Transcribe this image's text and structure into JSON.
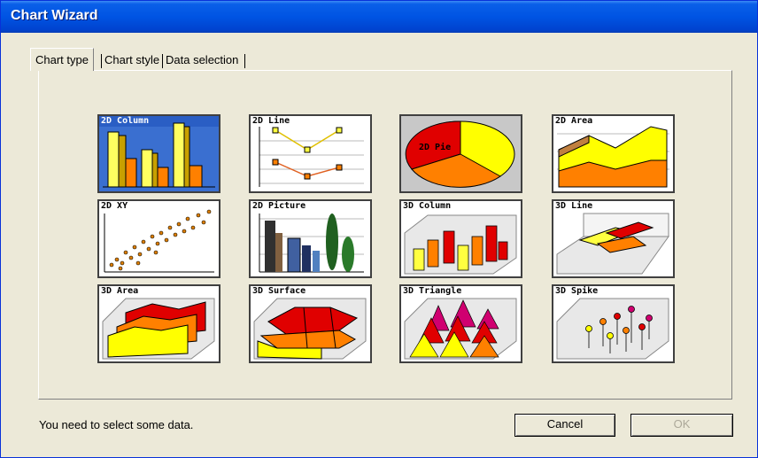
{
  "window": {
    "title": "Chart Wizard"
  },
  "tabs": [
    {
      "label": "Chart type",
      "active": true
    },
    {
      "label": "Chart style",
      "active": false
    },
    {
      "label": "Data selection",
      "active": false
    }
  ],
  "chart_types": [
    {
      "label": "2D Column",
      "icon": "2d-column-chart-icon",
      "selected": false
    },
    {
      "label": "2D Line",
      "icon": "2d-line-chart-icon",
      "selected": false
    },
    {
      "label": "2D Pie",
      "icon": "2d-pie-chart-icon",
      "selected": true
    },
    {
      "label": "2D Area",
      "icon": "2d-area-chart-icon",
      "selected": false
    },
    {
      "label": "2D XY",
      "icon": "2d-xy-chart-icon",
      "selected": false
    },
    {
      "label": "2D Picture",
      "icon": "2d-picture-chart-icon",
      "selected": false
    },
    {
      "label": "3D Column",
      "icon": "3d-column-chart-icon",
      "selected": false
    },
    {
      "label": "3D Line",
      "icon": "3d-line-chart-icon",
      "selected": false
    },
    {
      "label": "3D Area",
      "icon": "3d-area-chart-icon",
      "selected": false
    },
    {
      "label": "3D Surface",
      "icon": "3d-surface-chart-icon",
      "selected": false
    },
    {
      "label": "3D Triangle",
      "icon": "3d-triangle-chart-icon",
      "selected": false
    },
    {
      "label": "3D Spike",
      "icon": "3d-spike-chart-icon",
      "selected": false
    }
  ],
  "status": {
    "message": "You need to select some data."
  },
  "buttons": {
    "cancel": "Cancel",
    "ok": "OK"
  },
  "colors": {
    "titlebar": "#0054e3",
    "face": "#ece9d8",
    "yellow": "#ffff00",
    "orange": "#ff8000",
    "red": "#e00000",
    "blue": "#3070d0"
  }
}
